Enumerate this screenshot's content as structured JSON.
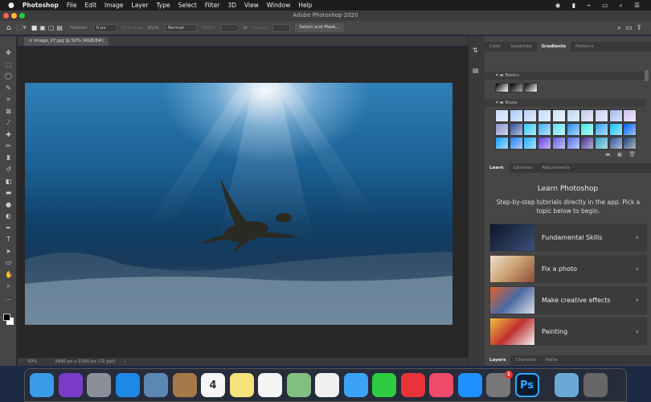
{
  "menubar": {
    "app": "Photoshop",
    "items": [
      "File",
      "Edit",
      "Image",
      "Layer",
      "Type",
      "Select",
      "Filter",
      "3D",
      "View",
      "Window",
      "Help"
    ]
  },
  "window": {
    "title": "Adobe Photoshop 2020"
  },
  "options": {
    "feather_label": "Feather:",
    "feather_value": "0 px",
    "anti_alias": "Anti-alias",
    "style_label": "Style:",
    "style_value": "Normal",
    "width_label": "Width:",
    "height_label": "Height:",
    "select_mask": "Select and Mask..."
  },
  "document": {
    "tab": "Image_27.jpg @ 50% (RGB/8#)",
    "zoom": "50%",
    "info": "3840 px x 2160 px (72 ppi)"
  },
  "gradients_panel": {
    "tabs": [
      "Color",
      "Swatches",
      "Gradients",
      "Patterns"
    ],
    "active": "Gradients",
    "groups": [
      "Basics",
      "Blues"
    ]
  },
  "learn_panel": {
    "tabs": [
      "Learn",
      "Libraries",
      "Adjustments"
    ],
    "title": "Learn Photoshop",
    "subtitle": "Step-by-step tutorials directly in the app. Pick a topic below to begin.",
    "items": [
      {
        "label": "Fundamental Skills",
        "color": "#1b2c4a"
      },
      {
        "label": "Fix a photo",
        "color": "#c9a070"
      },
      {
        "label": "Make creative effects",
        "color": "#4a6aa0"
      },
      {
        "label": "Painting",
        "color": "#c03030"
      }
    ]
  },
  "layers_panel": {
    "tabs": [
      "Layers",
      "Channels",
      "Paths"
    ]
  },
  "dock": {
    "apps": [
      {
        "name": "Finder",
        "color": "#3a9be8"
      },
      {
        "name": "Siri",
        "color": "#7a3cc8"
      },
      {
        "name": "Launchpad",
        "color": "#8a8f99"
      },
      {
        "name": "Safari",
        "color": "#1e88e5"
      },
      {
        "name": "Preview",
        "color": "#5c87b5"
      },
      {
        "name": "Notefile",
        "color": "#a47a4a"
      },
      {
        "name": "Calendar",
        "color": "#f5f5f5",
        "text": "4"
      },
      {
        "name": "Notes",
        "color": "#f5e27a"
      },
      {
        "name": "Reminders",
        "color": "#f5f5f5"
      },
      {
        "name": "Maps",
        "color": "#7fbf7f"
      },
      {
        "name": "Photos",
        "color": "#f0f0f0"
      },
      {
        "name": "Messages",
        "color": "#3aa3f5"
      },
      {
        "name": "FaceTime",
        "color": "#2ecc40"
      },
      {
        "name": "News",
        "color": "#e8333b"
      },
      {
        "name": "Music",
        "color": "#f04a6a"
      },
      {
        "name": "App Store",
        "color": "#1e90ff"
      },
      {
        "name": "System Preferences",
        "color": "#777",
        "badge": "1"
      },
      {
        "name": "Photoshop",
        "color": "#0a1b2e",
        "text": "Ps"
      },
      {
        "name": "Downloads",
        "color": "#6aa8d8"
      },
      {
        "name": "Trash",
        "color": "#666"
      }
    ]
  }
}
